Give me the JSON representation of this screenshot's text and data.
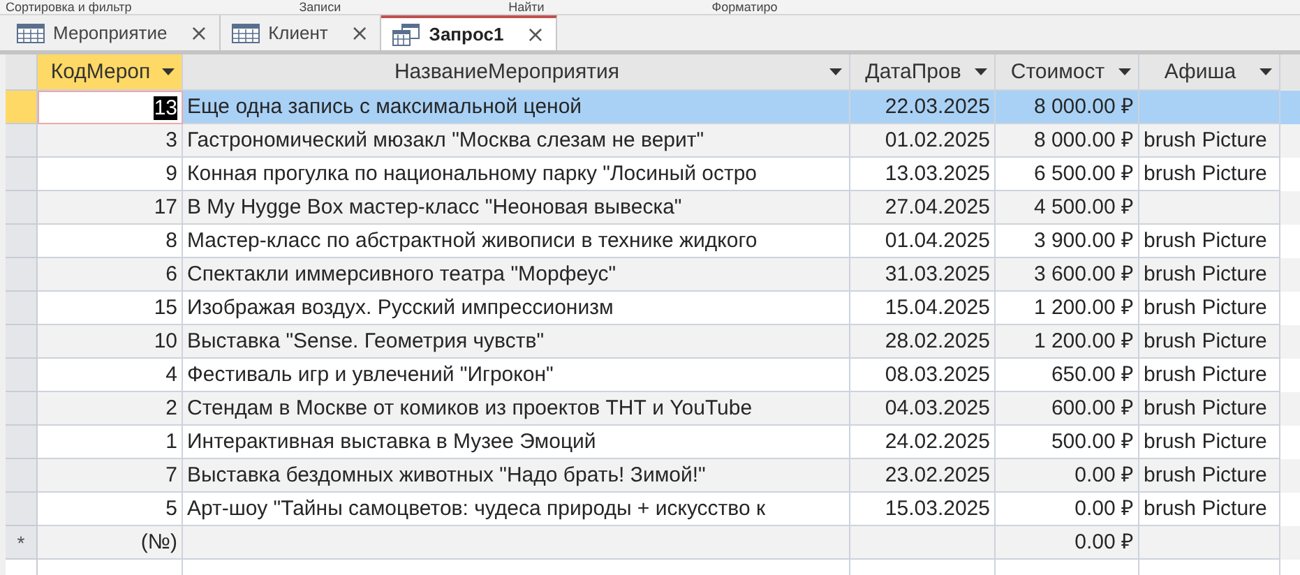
{
  "ribbon_groups": [
    "Сортировка и фильтр",
    "Записи",
    "Найти",
    "Форматиро"
  ],
  "tabs": [
    {
      "label": "Мероприятие",
      "kind": "table",
      "selected": false,
      "close": "×"
    },
    {
      "label": "Клиент",
      "kind": "table",
      "selected": false,
      "close": "×"
    },
    {
      "label": "Запрос1",
      "kind": "query",
      "selected": true,
      "close": "×"
    }
  ],
  "table": {
    "columns": [
      {
        "label": "КодМероп",
        "selected": true
      },
      {
        "label": "НазваниеМероприятия",
        "selected": false
      },
      {
        "label": "ДатаПров",
        "selected": false
      },
      {
        "label": "Стоимост",
        "selected": false
      },
      {
        "label": "Афиша",
        "selected": false
      }
    ],
    "rows": [
      {
        "id": "13",
        "name": "Еще одна запись с максимальной ценой",
        "date": "22.03.2025",
        "cost": "8 000.00 ₽",
        "selected": true
      },
      {
        "id": "3",
        "name": "Гастрономический мюзакл \"Москва слезам не верит\"",
        "date": "01.02.2025",
        "cost": "8 000.00 ₽",
        "afisha": "brush Picture",
        "selected": false
      },
      {
        "id": "9",
        "name": "Конная прогулка по национальному парку \"Лосиный остро",
        "date": "13.03.2025",
        "cost": "6 500.00 ₽",
        "afisha": "brush Picture",
        "selected": false
      },
      {
        "id": "17",
        "name": "В My Hygge Box мастер-класс \"Неоновая вывеска\"",
        "date": "27.04.2025",
        "cost": "4 500.00 ₽",
        "selected": false
      },
      {
        "id": "8",
        "name": "Мастер-класс по абстрактной живописи в технике жидкого",
        "date": "01.04.2025",
        "cost": "3 900.00 ₽",
        "afisha": "brush Picture",
        "selected": false
      },
      {
        "id": "6",
        "name": "Спектакли иммерсивного театра \"Морфеус\"",
        "date": "31.03.2025",
        "cost": "3 600.00 ₽",
        "afisha": "brush Picture",
        "selected": false
      },
      {
        "id": "15",
        "name": "Изображая воздух. Русский импрессионизм",
        "date": "15.04.2025",
        "cost": "1 200.00 ₽",
        "afisha": "brush Picture",
        "selected": false
      },
      {
        "id": "10",
        "name": "Выставка \"Sense. Геометрия чувств\"",
        "date": "28.02.2025",
        "cost": "1 200.00 ₽",
        "afisha": "brush Picture",
        "selected": false
      },
      {
        "id": "4",
        "name": "Фестиваль игр и увлечений \"Игрокон\"",
        "date": "08.03.2025",
        "cost": "650.00 ₽",
        "afisha": "brush Picture",
        "selected": false
      },
      {
        "id": "2",
        "name": "Стендам в Москве от комиков из проектов ТНТ и YouTube",
        "date": "04.03.2025",
        "cost": "600.00 ₽",
        "afisha": "brush Picture",
        "selected": false
      },
      {
        "id": "1",
        "name": "Интерактивная выставка в Музее Эмоций",
        "date": "24.02.2025",
        "cost": "500.00 ₽",
        "afisha": "brush Picture",
        "selected": false
      },
      {
        "id": "7",
        "name": "Выставка бездомных животных \"Надо брать! Зимой!\"",
        "date": "23.02.2025",
        "cost": "0.00 ₽",
        "afisha": "brush Picture",
        "selected": false
      },
      {
        "id": "5",
        "name": "Арт-шоу \"Тайны самоцветов: чудеса природы + искусство к",
        "date": "15.03.2025",
        "cost": "0.00 ₽",
        "afisha": "brush Picture",
        "selected": false
      }
    ],
    "new_record": {
      "marker": "*",
      "id": "(№)",
      "cost": "0.00 ₽"
    }
  }
}
